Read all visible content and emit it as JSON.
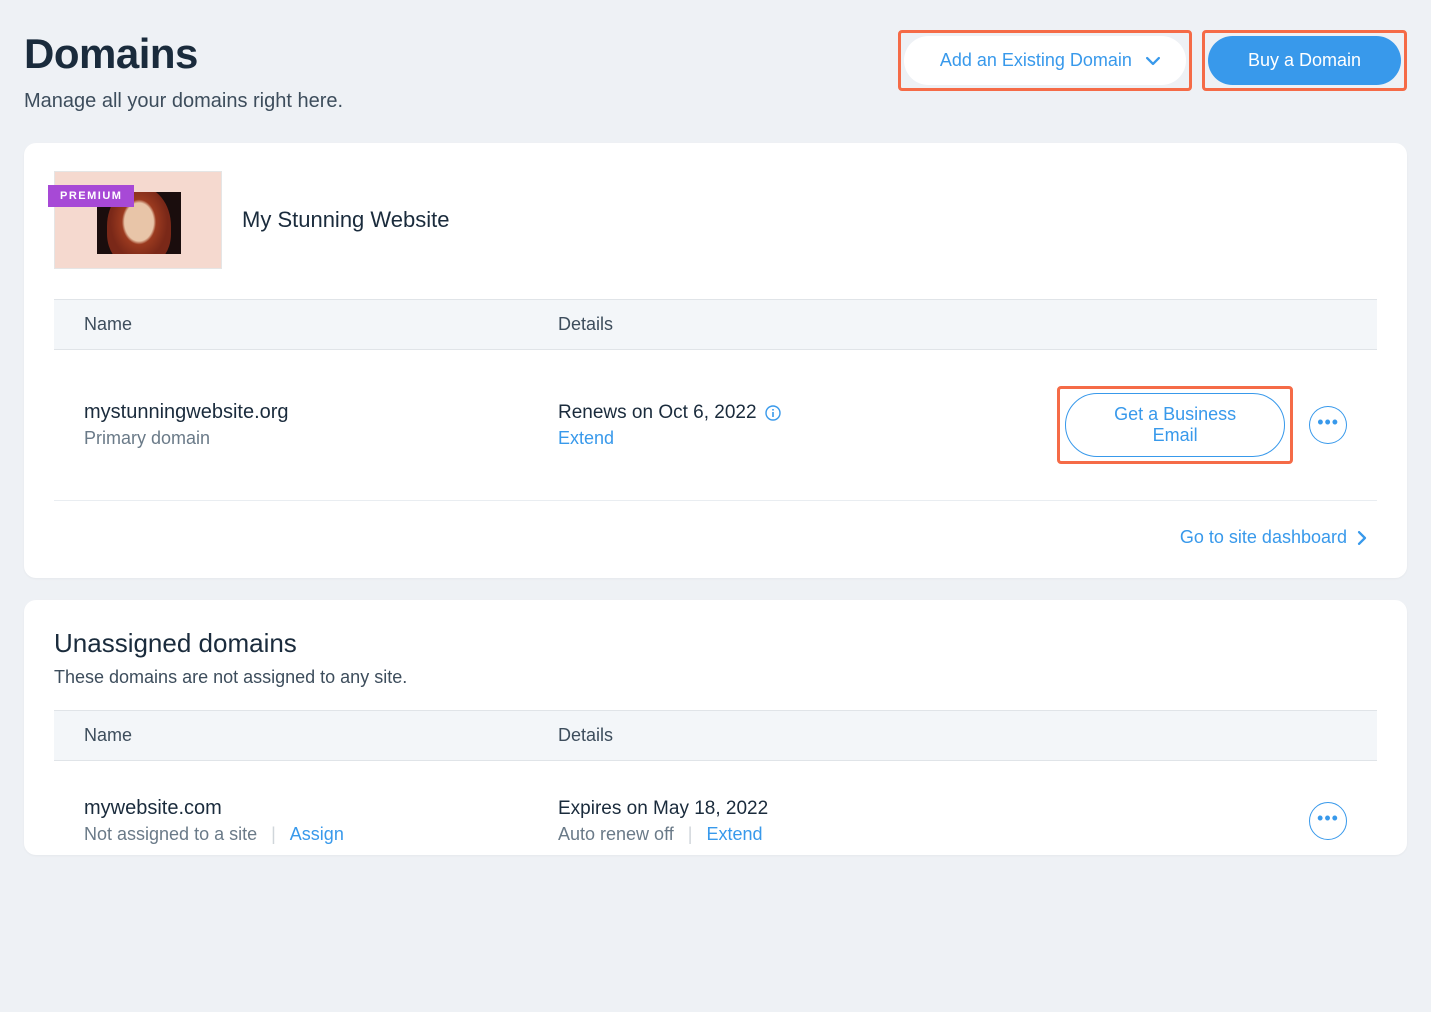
{
  "page": {
    "title": "Domains",
    "subtitle": "Manage all your domains right here."
  },
  "actions": {
    "add_existing": "Add an Existing Domain",
    "buy_domain": "Buy a Domain"
  },
  "site": {
    "premium_badge": "PREMIUM",
    "title": "My Stunning Website",
    "table": {
      "name_header": "Name",
      "details_header": "Details"
    },
    "domain": {
      "name": "mystunningwebsite.org",
      "sub": "Primary domain",
      "details_line1": "Renews on Oct 6, 2022",
      "extend": "Extend",
      "business_email": "Get a Business Email"
    },
    "dashboard_link": "Go to site dashboard"
  },
  "unassigned": {
    "title": "Unassigned domains",
    "subtitle": "These domains are not assigned to any site.",
    "table": {
      "name_header": "Name",
      "details_header": "Details"
    },
    "domain": {
      "name": "mywebsite.com",
      "sub": "Not assigned to a site",
      "assign": "Assign",
      "details_line1": "Expires on May 18, 2022",
      "details_line2": "Auto renew off",
      "extend": "Extend"
    }
  }
}
